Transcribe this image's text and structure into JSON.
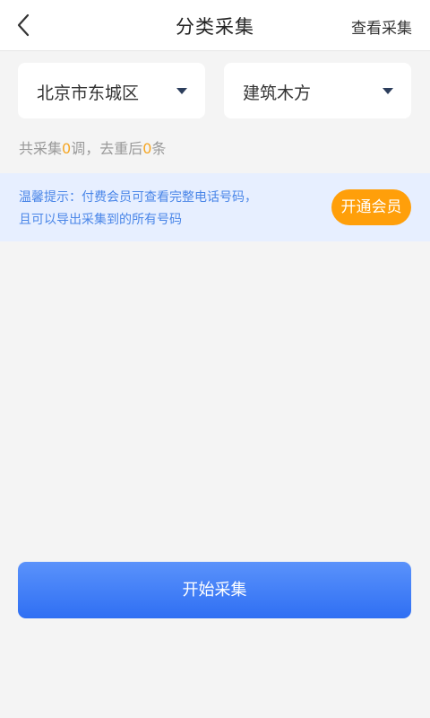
{
  "header": {
    "title": "分类采集",
    "view_link": "查看采集",
    "back_icon": "chevron-left-icon"
  },
  "filters": {
    "city": "北京市东城区",
    "category": "建筑木方",
    "caret_icon": "caret-down-icon"
  },
  "stats": {
    "prefix": "共采集",
    "collected": "0",
    "middle": "调，去重后",
    "deduped": "0",
    "suffix": "条"
  },
  "notice": {
    "line1": "温馨提示：付费会员可查看完整电话号码，",
    "line2": "且可以导出采集到的所有号码",
    "button_label": "开通会员"
  },
  "actions": {
    "start_label": "开始采集"
  },
  "colors": {
    "accent_blue": "#3a78f5",
    "notice_text": "#4a86e8",
    "notice_bg": "#e7efff",
    "orange": "#ff9f0a",
    "count_orange": "#f5a623"
  }
}
